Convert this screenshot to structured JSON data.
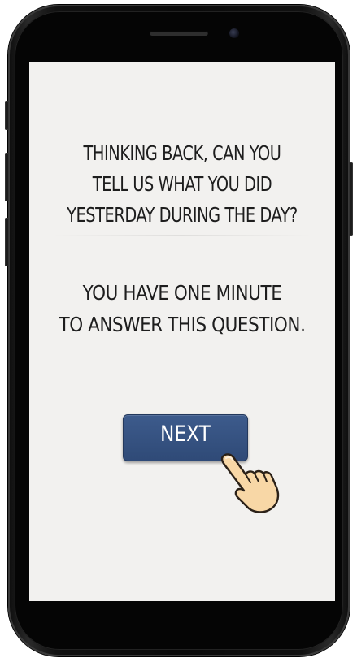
{
  "screen": {
    "question": "THINKING BACK, CAN YOU\nTELL US WHAT YOU DID\nYESTERDAY DURING THE DAY?",
    "instruction": "YOU HAVE ONE MINUTE\nTO ANSWER THIS QUESTION.",
    "next_button": {
      "label": "NEXT"
    },
    "pointer_icon": "pointing-hand-icon"
  },
  "colors": {
    "screen_background": "#f2f1ef",
    "text": "#1d1d1d",
    "button": "#34507f",
    "button_text": "#ffffff",
    "phone_body": "#0a0a0a"
  }
}
